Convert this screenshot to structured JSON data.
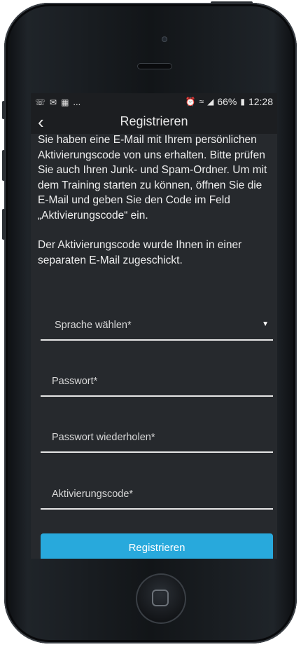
{
  "status_bar": {
    "left_icons": [
      "whatsapp-icon",
      "message-icon",
      "notification-icon"
    ],
    "left_ellipsis": "...",
    "battery_percent": "66%",
    "time": "12:28",
    "right_icons": [
      "alarm-icon",
      "wifi-icon",
      "signal-icon",
      "battery-icon"
    ]
  },
  "nav": {
    "back_icon": "chevron-left-icon",
    "title": "Registrieren"
  },
  "content": {
    "paragraph1": "Sie haben eine E-Mail mit Ihrem persönlichen Aktivierungscode von uns erhalten. Bitte prüfen Sie auch Ihren Junk- und Spam-Ordner. Um mit dem Training starten zu können, öffnen Sie die E-Mail und geben Sie den Code im Feld „Aktivierungscode“ ein.",
    "paragraph2": "Der Aktivierungscode wurde Ihnen in einer separaten E-Mail zugeschickt."
  },
  "form": {
    "language_label": "Sprache wählen*",
    "password_label": "Passwort*",
    "password_repeat_label": "Passwort wiederholen*",
    "activation_code_label": "Aktivierungscode*",
    "submit_label": "Registrieren"
  },
  "colors": {
    "screen_bg": "#26292d",
    "bar_bg": "#1c1e21",
    "accent": "#28a9dc",
    "text": "#eeeeee"
  }
}
